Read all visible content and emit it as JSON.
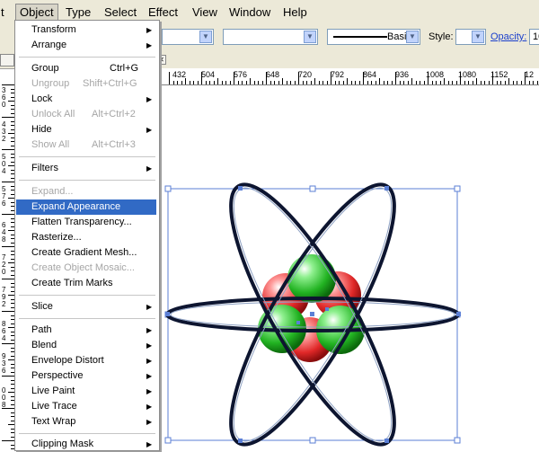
{
  "menubar": {
    "items": [
      "t",
      "Object",
      "Type",
      "Select",
      "Effect",
      "View",
      "Window",
      "Help"
    ]
  },
  "toolbar": {
    "stroke_style_label": "Basic",
    "style_label": "Style:",
    "opacity_label": "Opacity:",
    "opacity_value": "10"
  },
  "ruler_top": {
    "labels": [
      "432",
      "504",
      "576",
      "648",
      "720",
      "792",
      "864",
      "936",
      "1008",
      "1080",
      "1152",
      "12"
    ]
  },
  "ruler_left": {
    "digits": [
      "3",
      "6",
      "0",
      "4",
      "3",
      "2",
      "5",
      "0",
      "4",
      "5",
      "7",
      "6",
      "6",
      "4",
      "8",
      "7",
      "2",
      "0",
      "7",
      "9",
      "2",
      "8",
      "6",
      "4",
      "9",
      "3",
      "6",
      "0",
      "0",
      "8"
    ]
  },
  "object_menu": {
    "items": [
      {
        "label": "Transform",
        "shortcut": "",
        "submenu": true,
        "enabled": true
      },
      {
        "label": "Arrange",
        "shortcut": "",
        "submenu": true,
        "enabled": true
      },
      {
        "label": "Group",
        "shortcut": "Ctrl+G",
        "submenu": false,
        "enabled": true
      },
      {
        "label": "Ungroup",
        "shortcut": "Shift+Ctrl+G",
        "submenu": false,
        "enabled": false
      },
      {
        "label": "Lock",
        "shortcut": "",
        "submenu": true,
        "enabled": true
      },
      {
        "label": "Unlock All",
        "shortcut": "Alt+Ctrl+2",
        "submenu": false,
        "enabled": false
      },
      {
        "label": "Hide",
        "shortcut": "",
        "submenu": true,
        "enabled": true
      },
      {
        "label": "Show All",
        "shortcut": "Alt+Ctrl+3",
        "submenu": false,
        "enabled": false
      },
      {
        "label": "Filters",
        "shortcut": "",
        "submenu": true,
        "enabled": true
      },
      {
        "label": "Expand...",
        "shortcut": "",
        "submenu": false,
        "enabled": false
      },
      {
        "label": "Expand Appearance",
        "shortcut": "",
        "submenu": false,
        "enabled": true,
        "highlighted": true
      },
      {
        "label": "Flatten Transparency...",
        "shortcut": "",
        "submenu": false,
        "enabled": true
      },
      {
        "label": "Rasterize...",
        "shortcut": "",
        "submenu": false,
        "enabled": true
      },
      {
        "label": "Create Gradient Mesh...",
        "shortcut": "",
        "submenu": false,
        "enabled": true
      },
      {
        "label": "Create Object Mosaic...",
        "shortcut": "",
        "submenu": false,
        "enabled": false
      },
      {
        "label": "Create Trim Marks",
        "shortcut": "",
        "submenu": false,
        "enabled": true
      },
      {
        "label": "Slice",
        "shortcut": "",
        "submenu": true,
        "enabled": true
      },
      {
        "label": "Path",
        "shortcut": "",
        "submenu": true,
        "enabled": true
      },
      {
        "label": "Blend",
        "shortcut": "",
        "submenu": true,
        "enabled": true
      },
      {
        "label": "Envelope Distort",
        "shortcut": "",
        "submenu": true,
        "enabled": true
      },
      {
        "label": "Perspective",
        "shortcut": "",
        "submenu": true,
        "enabled": true
      },
      {
        "label": "Live Paint",
        "shortcut": "",
        "submenu": true,
        "enabled": true
      },
      {
        "label": "Live Trace",
        "shortcut": "",
        "submenu": true,
        "enabled": true
      },
      {
        "label": "Text Wrap",
        "shortcut": "",
        "submenu": true,
        "enabled": true
      },
      {
        "label": "Clipping Mask",
        "shortcut": "",
        "submenu": true,
        "enabled": true
      }
    ]
  },
  "colors": {
    "menubar_bg": "#ece9d8",
    "highlight": "#316ac5",
    "selection": "#5b7fd6",
    "orbit": "#0d1530",
    "sphere_green": "#22b322",
    "sphere_red": "#e02828"
  }
}
